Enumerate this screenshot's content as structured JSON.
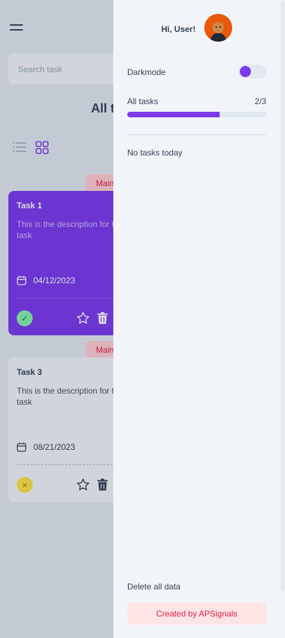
{
  "main": {
    "search_placeholder": "Search task",
    "title": "All t",
    "tasks": [
      {
        "tag": "Main",
        "title": "Task 1",
        "description": "This is the description for t task",
        "date": "04/12/2023",
        "status": "done",
        "status_symbol": "✓",
        "color": "#7c3aed"
      },
      {
        "tag": "Main",
        "title": "Task 3",
        "description": "This is the description for t task",
        "date": "08/21/2023",
        "status": "pending",
        "status_symbol": "×",
        "color": "#f1f5f9"
      }
    ]
  },
  "drawer": {
    "greeting": "Hi, User!",
    "darkmode_label": "Darkmode",
    "darkmode_on": false,
    "progress_label": "All tasks",
    "progress_count": "2/3",
    "progress_fraction": 0.667,
    "empty_message": "No tasks today",
    "delete_label": "Delete all data",
    "credit": "Created by APSignals"
  },
  "colors": {
    "accent": "#7c3aed",
    "danger": "#e11d48",
    "panel": "#f1f5f9"
  },
  "icons": [
    "menu-icon",
    "list-view-icon",
    "grid-view-icon",
    "calendar-icon",
    "check-icon",
    "close-icon",
    "star-icon",
    "trash-icon",
    "avatar-cat"
  ]
}
